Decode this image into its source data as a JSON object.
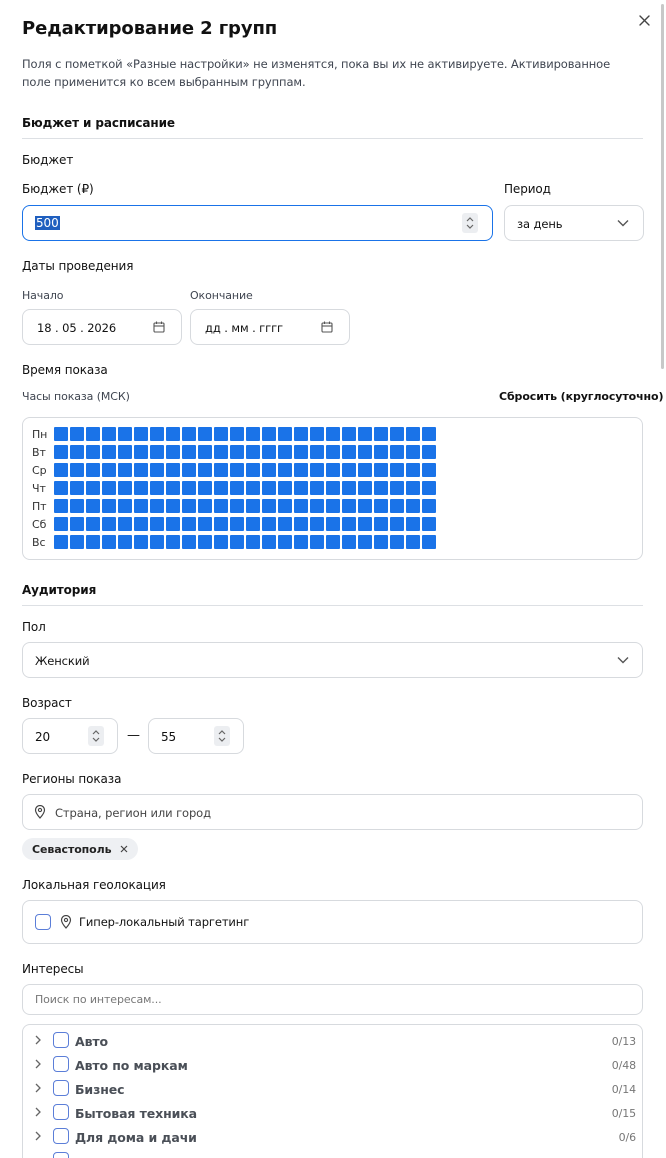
{
  "dialog": {
    "title": "Редактирование 2 групп",
    "description": "Поля с пометкой «Разные настройки» не изменятся, пока вы их не активируете. Активированное поле применится ко всем выбранным группам."
  },
  "budget_section": {
    "heading": "Бюджет и расписание",
    "budget_group_label": "Бюджет",
    "budget_label": "Бюджет (₽)",
    "budget_value": "500",
    "period_label": "Период",
    "period_value": "за день",
    "dates_label": "Даты проведения",
    "start_label": "Начало",
    "start_value": "18 . 05 . 2026",
    "end_label": "Окончание",
    "end_placeholder": "дд . мм . гггг",
    "time_label": "Время показа",
    "hours_label": "Часы показа (МСК)",
    "reset_label": "Сбросить (круглосуточно)",
    "days": [
      "Пн",
      "Вт",
      "Ср",
      "Чт",
      "Пт",
      "Сб",
      "Вс"
    ],
    "hours_per_day": 24
  },
  "audience_section": {
    "heading": "Аудитория",
    "gender_label": "Пол",
    "gender_value": "Женский",
    "age_label": "Возраст",
    "age_from": "20",
    "age_dash": "—",
    "age_to": "55",
    "regions_label": "Регионы показа",
    "regions_placeholder": "Страна, регион или город",
    "region_chip": "Севастополь",
    "local_label": "Локальная геолокация",
    "hyperlocal_label": "Гипер-локальный таргетинг",
    "interests_label": "Интересы",
    "interests_placeholder": "Поиск по интересам...",
    "interests": [
      {
        "name": "Авто",
        "count": "0/13"
      },
      {
        "name": "Авто по маркам",
        "count": "0/48"
      },
      {
        "name": "Бизнес",
        "count": "0/14"
      },
      {
        "name": "Бытовая техника",
        "count": "0/15"
      },
      {
        "name": "Для дома и дачи",
        "count": "0/6"
      }
    ]
  },
  "colors": {
    "accent": "#1a73e8",
    "border": "#d7dade",
    "checkbox": "#5b7ed8"
  }
}
